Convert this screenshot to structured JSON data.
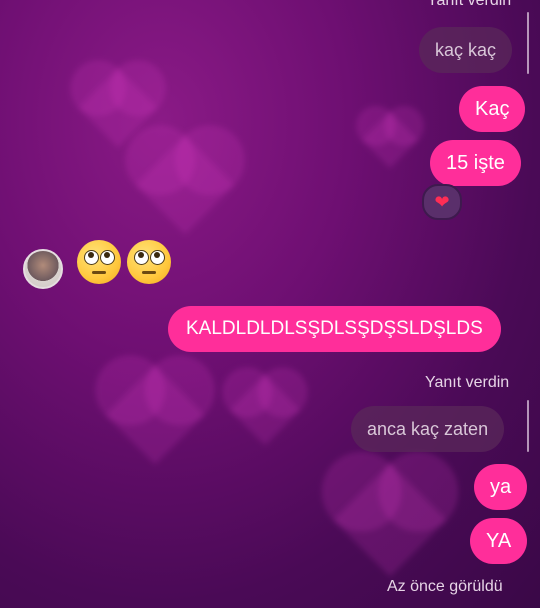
{
  "messages": {
    "reply_label_top": "Yanıt verdin",
    "quoted_1": "kaç kaç",
    "sent_1": "Kaç",
    "sent_2": "15 işte",
    "reaction_icon": "red-heart",
    "received_emoji": "face-with-rolling-eyes",
    "sent_3": "KALDLDLDLSŞDLSŞDŞSLDŞLDS",
    "reply_label": "Yanıt verdin",
    "quoted_2": "anca kaç zaten",
    "sent_4": "ya",
    "sent_5": "YA",
    "seen_status": "Az önce görüldü"
  },
  "colors": {
    "sent_bubble": "#ff2e9a",
    "quoted_bubble": "#5a285a",
    "background": "#6e0f72"
  }
}
